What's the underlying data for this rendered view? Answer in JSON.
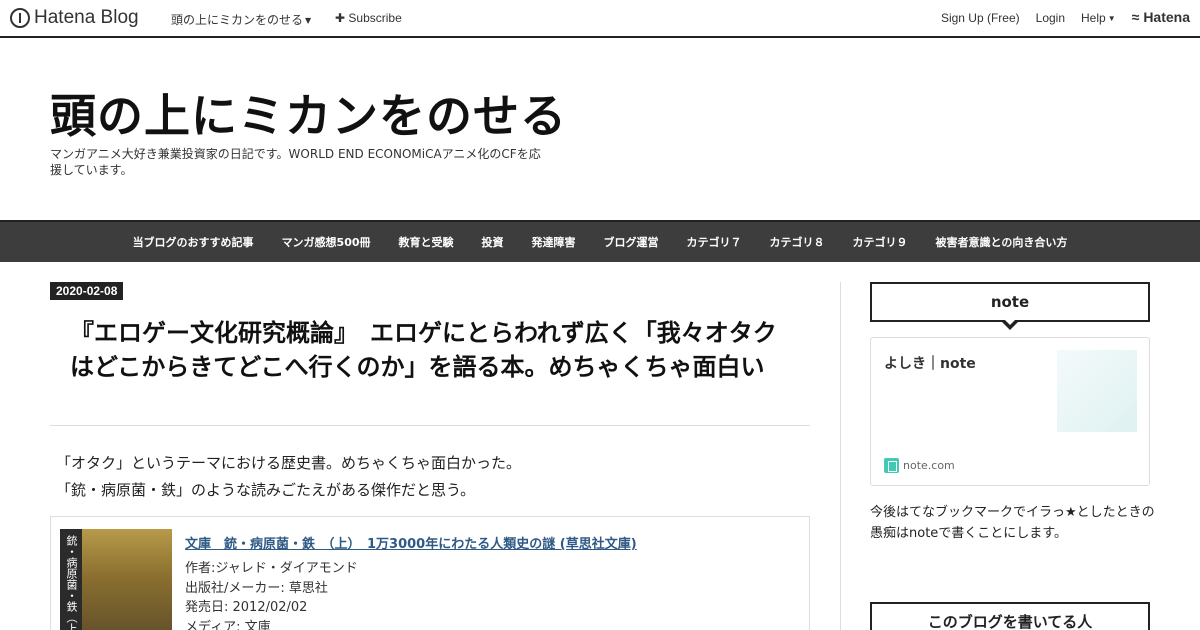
{
  "global_header": {
    "logo_text": "Hatena Blog",
    "blog_name": "頭の上にミカンをのせる",
    "subscribe": "✚ Subscribe",
    "signup": "Sign Up (Free)",
    "login": "Login",
    "help": "Help",
    "hatena": "Hatena"
  },
  "blog": {
    "title": "頭の上にミカンをのせる",
    "description": "マンガアニメ大好き兼業投資家の日記です。WORLD END ECONOMiCAアニメ化のCFを応援しています。"
  },
  "nav": {
    "items": [
      "当ブログのおすすめ記事",
      "マンガ感想500冊",
      "教育と受験",
      "投資",
      "発達障害",
      "ブログ運営",
      "カテゴリ７",
      "カテゴリ８",
      "カテゴリ９",
      "被害者意識との向き合い方"
    ]
  },
  "entry": {
    "date": "2020-02-08",
    "title": "『エロゲー文化研究概論』　エロゲにとらわれず広く「我々オタクはどこからきてどこへ行くのか」を語る本。めちゃくちゃ面白い",
    "lines": [
      "「オタク」というテーマにおける歴史書。めちゃくちゃ面白かった。",
      "「銃・病原菌・鉄」のような読みごたえがある傑作だと思う。"
    ]
  },
  "product": {
    "cover_text": "銃・病原菌・鉄（上）",
    "link": "文庫　銃・病原菌・鉄　（上）　1万3000年にわたる人類史の謎 (草思社文庫)",
    "author": "作者:ジャレド・ダイアモンド",
    "publisher": "出版社/メーカー: 草思社",
    "release": "発売日: 2012/02/02",
    "media": "メディア: 文庫"
  },
  "sidebar": {
    "module1_title": "note",
    "card_title": "よしき｜note",
    "card_source": "note.com",
    "text": "今後はてなブックマークでイラっ★としたときの愚痴はnoteで書くことにします。",
    "module2_title": "このブログを書いてる人"
  }
}
